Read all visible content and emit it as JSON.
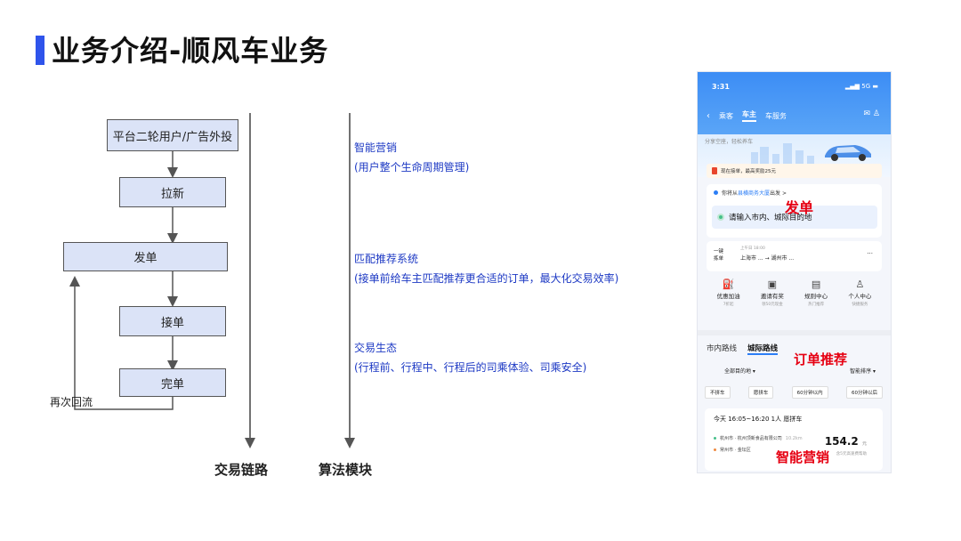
{
  "page": {
    "title": "业务介绍-顺风车业务"
  },
  "flow": {
    "boxes": [
      "平台二轮用户/广告外投",
      "拉新",
      "发单",
      "接单",
      "完单"
    ],
    "loop_label": "再次回流"
  },
  "axes": {
    "trade_chain": "交易链路",
    "algorithm": "算法模块"
  },
  "algorithms": [
    {
      "name": "智能营销",
      "desc": "(用户整个生命周期管理)"
    },
    {
      "name": "匹配推荐系统",
      "desc": "(接单前给车主匹配推荐更合适的订单，最大化交易效率)"
    },
    {
      "name": "交易生态",
      "desc": "(行程前、行程中、行程后的司乘体验、司乘安全)"
    }
  ],
  "phone": {
    "time": "3:31",
    "status": "5G",
    "tabs": [
      "乘客",
      "车主",
      "车服务"
    ],
    "active_tab": 1,
    "banner_text": "分享空座，轻松养车",
    "promo_text": "现在接单，最高奖励25元",
    "from_prefix": "你将从",
    "from_link": "县横商务大厦",
    "from_suffix": "出发 >",
    "to_placeholder": "请输入市内、城际目的地",
    "history": {
      "key1": "一键",
      "key2": "拣单",
      "time": "上午日 18:00",
      "route": "上海市 ... → 湖州市 ...",
      "more": "···"
    },
    "grid": [
      {
        "icon": "gas-station-icon",
        "glyph": "⛽",
        "label": "优惠加油",
        "sub": "7折起"
      },
      {
        "icon": "gift-icon",
        "glyph": "🎁",
        "label": "邀请有奖",
        "sub": "领50元现金"
      },
      {
        "icon": "rules-icon",
        "glyph": "▤",
        "label": "规则中心",
        "sub": "热门推荐"
      },
      {
        "icon": "person-icon",
        "glyph": "♙",
        "label": "个人中心",
        "sub": "快捷服务"
      }
    ],
    "routes": [
      "市内路线",
      "城际路线"
    ],
    "selected_route": 1,
    "filters": [
      "全部目的地 ▾",
      "智能排序 ▾"
    ],
    "chips": [
      "不拼车",
      "愿拼车",
      "60分钟以内",
      "60分钟以后"
    ],
    "order": {
      "header": "今天 16:05~16:20   1人   愿拼车",
      "from": "杭州市 · 杭州顶新食品有限公司",
      "from_dist": "10.2km",
      "to": "常州市 · 金坛区",
      "price": "154.2",
      "price_unit": "元",
      "note": "含5元高速费帮助"
    }
  },
  "callouts": {
    "dispatch": "发单",
    "recommend": "订单推荐",
    "marketing": "智能营销"
  },
  "colors": {
    "accent": "#2f54eb",
    "box_fill": "#dbe3f7",
    "algo_text": "#1d39c4",
    "callout": "#e60012",
    "phone_blue": "#3c8df5"
  }
}
